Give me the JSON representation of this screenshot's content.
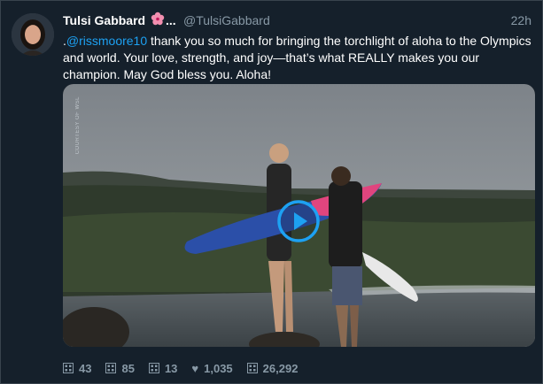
{
  "tweet": {
    "author_name": "Tulsi Gabbard",
    "ellipsis": "...",
    "handle": "@TulsiGabbard",
    "time": "22h",
    "text_prefix": ".",
    "mention": "@rissmoore10",
    "text_body": " thank you so much for bringing the torchlight of aloha to the Olympics and world. Your love, strength, and joy—that’s what REALLY makes you our champion. May God bless you. Aloha!",
    "media_credit": "COURTESY OF WSL"
  },
  "actions": {
    "first_count": "43",
    "second_count": "85",
    "third_count": "13",
    "likes_count": "1,035",
    "fifth_count": "26,292"
  },
  "icons": {
    "emoji": "hibiscus-icon",
    "media": "play-icon",
    "like": "heart-icon"
  },
  "colors": {
    "background": "#15202b",
    "link": "#1da1f2",
    "muted": "#8899a6",
    "play": "#1da1f2"
  }
}
